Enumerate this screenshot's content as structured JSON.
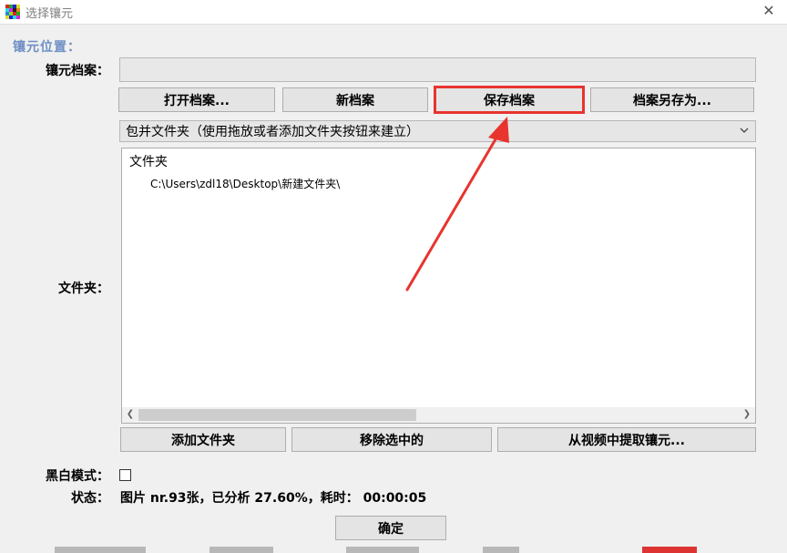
{
  "window": {
    "title": "选择镶元",
    "close_glyph": "✕"
  },
  "section": {
    "label": "镶元位置："
  },
  "archive": {
    "label": "镶元档案：",
    "value": "",
    "buttons": {
      "open": "打开档案...",
      "new": "新档案",
      "save": "保存档案",
      "save_as": "档案另存为..."
    }
  },
  "dropdown": {
    "selected": "包并文件夹（使用拖放或者添加文件夹按钮来建立）"
  },
  "folders": {
    "label": "文件夹：",
    "root": "文件夹",
    "items": [
      "C:\\Users\\zdl18\\Desktop\\新建文件夹\\"
    ],
    "buttons": {
      "add": "添加文件夹",
      "remove": "移除选中的",
      "extract": "从视频中提取镶元..."
    }
  },
  "bw_mode": {
    "label": "黑白模式：",
    "checked": false
  },
  "status": {
    "label": "状态：",
    "text": "图片 nr.93张，已分析 27.60%，耗时： 00:00:05"
  },
  "confirm": {
    "label": "确定"
  },
  "colors": {
    "annotation": "#e8342e",
    "section_label": "#6e8fc6"
  },
  "icons": {
    "app": "mosaic-grid-icon",
    "close": "close-icon",
    "dropdown": "chevron-down-icon",
    "scroll_left": "chevron-left-icon",
    "scroll_right": "chevron-right-icon"
  }
}
